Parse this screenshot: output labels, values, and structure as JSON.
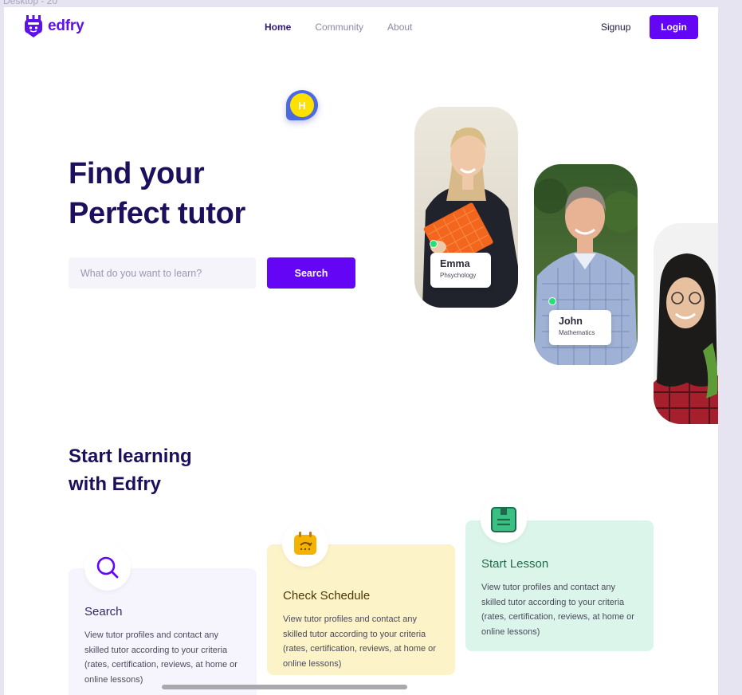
{
  "frame_label": "Desktop - 20",
  "brand": {
    "name": "edfry",
    "color": "#5f12e8"
  },
  "nav": {
    "links": [
      {
        "label": "Home",
        "active": true
      },
      {
        "label": "Community",
        "active": false
      },
      {
        "label": "About",
        "active": false
      }
    ],
    "signup": "Signup",
    "login": "Login"
  },
  "hero": {
    "title_line1": "Find your",
    "title_line2": "Perfect tutor",
    "search_placeholder": "What do you want to learn?",
    "search_button": "Search",
    "floating_badge": "H"
  },
  "tutors": [
    {
      "name": "Emma",
      "subject": "Phsychology"
    },
    {
      "name": "John",
      "subject": "Mathematics"
    }
  ],
  "section": {
    "title_line1": "Start learning",
    "title_line2": "with Edfry"
  },
  "features": [
    {
      "icon": "search-icon",
      "title": "Search",
      "description": "View tutor profiles and contact any skilled tutor according to your criteria (rates, certification, reviews, at home or online lessons)"
    },
    {
      "icon": "calendar-icon",
      "title": "Check Schedule",
      "description": "View tutor profiles and contact any skilled tutor according to your criteria (rates, certification, reviews, at home or online lessons)"
    },
    {
      "icon": "lesson-book-icon",
      "title": "Start Lesson",
      "description": "View tutor profiles and contact any skilled tutor according to your criteria (rates, certification, reviews, at home or online lessons)"
    }
  ],
  "colors": {
    "primary": "#6405f5",
    "heading": "#1d0f5c",
    "online_dot": "#22e07a"
  }
}
